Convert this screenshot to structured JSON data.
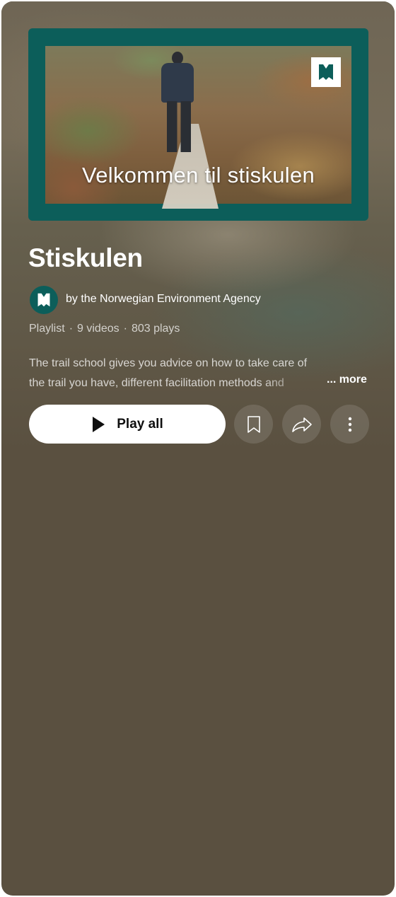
{
  "playlist": {
    "thumbnail_caption": "Velkommen til stiskulen",
    "title": "Stiskulen",
    "owner": "by the Norwegian Environment Agency",
    "type": "Playlist",
    "video_count": "9 videos",
    "plays": "803 plays",
    "separator": "·",
    "description_line1": "The trail school gives you advice on how to take care of",
    "description_line2": "the trail you have, different facilitation methods and",
    "more_label": "... more"
  },
  "actions": {
    "play_all_label": "Play all",
    "save_icon": "bookmark-icon",
    "share_icon": "share-icon",
    "more_icon": "more-vertical-icon"
  },
  "colors": {
    "panel_background": "#5a5040",
    "brand_teal": "#0c5e5a",
    "play_button_bg": "#ffffff"
  }
}
